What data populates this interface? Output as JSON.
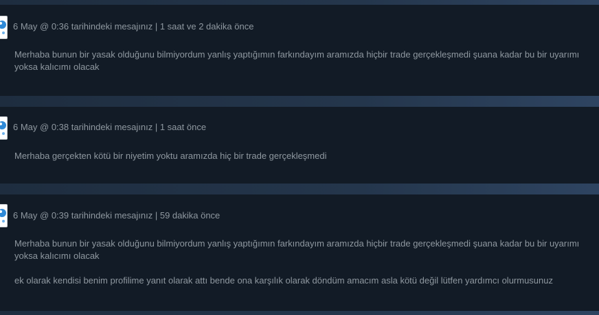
{
  "messages": [
    {
      "header": "6 May @ 0:36 tarihindeki mesajınız | 1 saat ve 2 dakika önce",
      "paragraphs": [
        [
          "Merhaba bunun bir yasak olduğunu bilmiyordum yanlış yaptığımın farkındayım aramızda hiçbir trade gerçekleşmedi şuana kadar bu bir uyarımı",
          "yoksa kalıcımı olacak"
        ]
      ]
    },
    {
      "header": "6 May @ 0:38 tarihindeki mesajınız | 1 saat önce",
      "paragraphs": [
        [
          "Merhaba gerçekten kötü bir niyetim yoktu aramızda hiç bir trade gerçekleşmedi"
        ]
      ]
    },
    {
      "header": "6 May @ 0:39 tarihindeki mesajınız | 59 dakika önce",
      "paragraphs": [
        [
          "Merhaba bunun bir yasak olduğunu bilmiyordum yanlış yaptığımın farkındayım aramızda hiçbir trade gerçekleşmedi şuana kadar bu bir uyarımı",
          "yoksa kalıcımı olacak"
        ],
        [
          "ek olarak kendisi benim profilime yanıt olarak attı bende ona karşılık olarak döndüm amacım asla kötü değil lütfen yardımcı olurmusunuz"
        ]
      ]
    }
  ],
  "icons": {
    "avatar": "user-avatar-icon"
  },
  "colors": {
    "page_background": "#1b2838",
    "message_background": "#121b26",
    "text": "#8f98a0"
  }
}
